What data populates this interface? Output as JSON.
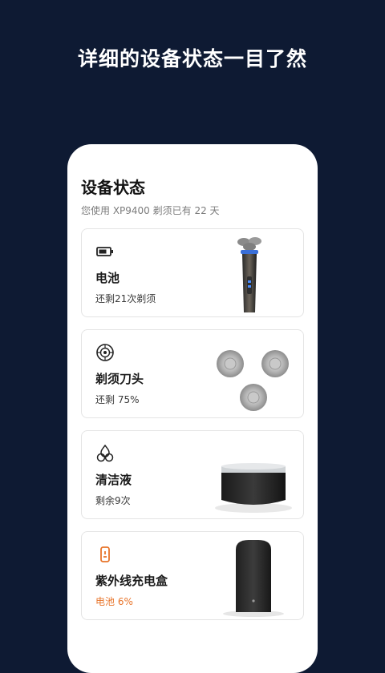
{
  "headline": "详细的设备状态一目了然",
  "screen": {
    "title": "设备状态",
    "subtitle": "您使用 XP9400 剃须已有 22 天"
  },
  "cards": [
    {
      "name": "电池",
      "status": "还剩21次剃须",
      "icon": "battery-icon"
    },
    {
      "name": "剃须刀头",
      "status": "还剩 75%",
      "icon": "blade-icon"
    },
    {
      "name": "清洁液",
      "status": "剩余9次",
      "icon": "cleaning-fluid-icon"
    },
    {
      "name": "紫外线充电盒",
      "status": "电池 6%",
      "icon": "uv-case-icon"
    }
  ],
  "colors": {
    "background": "#0e1a33",
    "warning": "#e8742a"
  }
}
